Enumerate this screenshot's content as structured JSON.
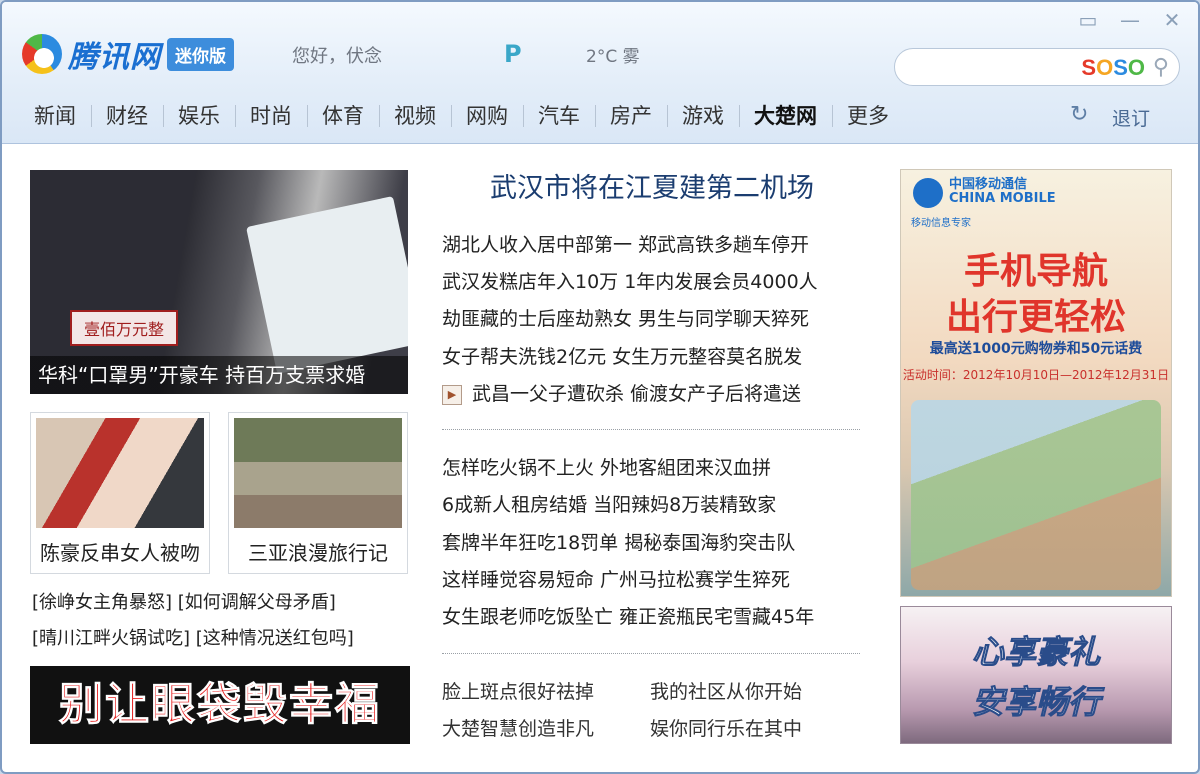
{
  "header": {
    "logo_text": "腾讯网",
    "logo_badge": "迷你版",
    "greeting": "您好，伏念",
    "weather": "2°C 雾",
    "weather_icon": "P",
    "search_placeholder": "",
    "search_brand": [
      "S",
      "O",
      "S",
      "O"
    ]
  },
  "nav": {
    "items": [
      "新闻",
      "财经",
      "娱乐",
      "时尚",
      "体育",
      "视频",
      "网购",
      "汽车",
      "房产",
      "游戏",
      "大楚网",
      "更多"
    ],
    "active": "大楚网",
    "logout": "退订"
  },
  "left": {
    "hero_caption": "华科“口罩男”开豪车 持百万支票求婚",
    "hero_label": "壹佰万元整",
    "thumbs": [
      "陈豪反串女人被吻",
      "三亚浪漫旅行记"
    ],
    "links": [
      [
        "[徐峥女主角暴怒]",
        "[如何调解父母矛盾]"
      ],
      [
        "[晴川江畔火锅试吃]",
        "[这种情况送红包吗]"
      ]
    ],
    "banner": "别让眼袋毁幸福"
  },
  "center": {
    "headline": "武汉市将在江夏建第二机场",
    "group1": [
      "湖北人收入居中部第一 郑武高铁多趟车停开",
      "武汉发糕店年入10万 1年内发展会员4000人",
      "劫匪藏的士后座劫熟女 男生与同学聊天猝死",
      "女子帮夫洗钱2亿元 女生万元整容莫名脱发",
      "武昌一父子遭砍杀 偷渡女产子后将遣送"
    ],
    "group2": [
      "怎样吃火锅不上火 外地客組团来汉血拼",
      "6成新人租房结婚 当阳辣妈8万装精致家",
      "套牌半年狂吃18罚单 揭秘泰国海豹突击队",
      "这样睡觉容易短命 广州马拉松赛学生猝死",
      "女生跟老师吃饭坠亡 雍正瓷瓶民宅雪藏45年"
    ],
    "bottom": [
      [
        "脸上斑点很好祛掉",
        "我的社区从你开始"
      ],
      [
        "大楚智慧创造非凡",
        "娱你同行乐在其中"
      ]
    ]
  },
  "right": {
    "cm_logo": "中国移动通信",
    "cm_logo_en": "CHINA MOBILE",
    "cm_sub": "移动信息专家",
    "ad_title1": "手机导航",
    "ad_title2": "出行更轻松",
    "ad_line": "最高送1000元购物券和50元话费",
    "ad_date": "活动时间：2012年10月10日—2012年12月31日",
    "ad2_line1": "心享豪礼",
    "ad2_line2": "安享畅行"
  }
}
